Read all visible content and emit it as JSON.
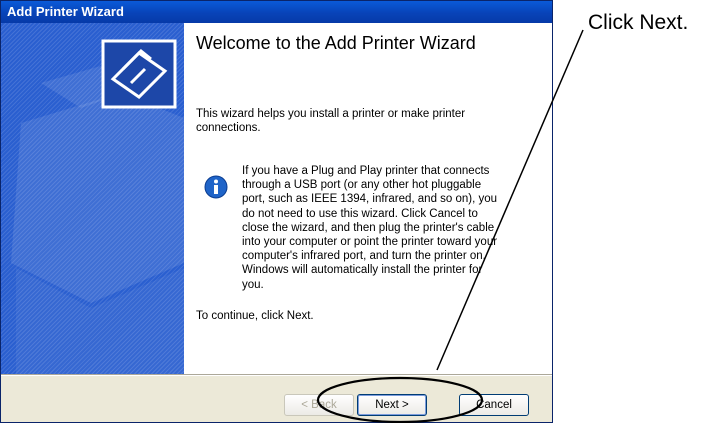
{
  "window": {
    "title": "Add Printer Wizard"
  },
  "content": {
    "heading": "Welcome to the Add Printer Wizard",
    "intro": "This wizard helps you install a printer or make printer connections.",
    "info": "If you have a Plug and Play printer that connects through a USB port (or any other hot pluggable port, such as IEEE 1394, infrared, and so on), you do not need to use this wizard. Click Cancel to close the wizard, and then plug the printer's cable into your computer or point the printer toward your computer's infrared port, and turn the printer on. Windows will automatically install the printer for you.",
    "continue": "To continue, click Next."
  },
  "buttons": {
    "back": "< Back",
    "next": "Next >",
    "cancel": "Cancel"
  },
  "annotation": {
    "text": "Click Next."
  },
  "icons": {
    "sidebar_logo": "printer-icon",
    "info": "info-icon"
  },
  "colors": {
    "titlebar": "#0843b8",
    "sidebar": "#2a5fd0",
    "dialog": "#ece9d8",
    "info_blue": "#1f64c8"
  }
}
